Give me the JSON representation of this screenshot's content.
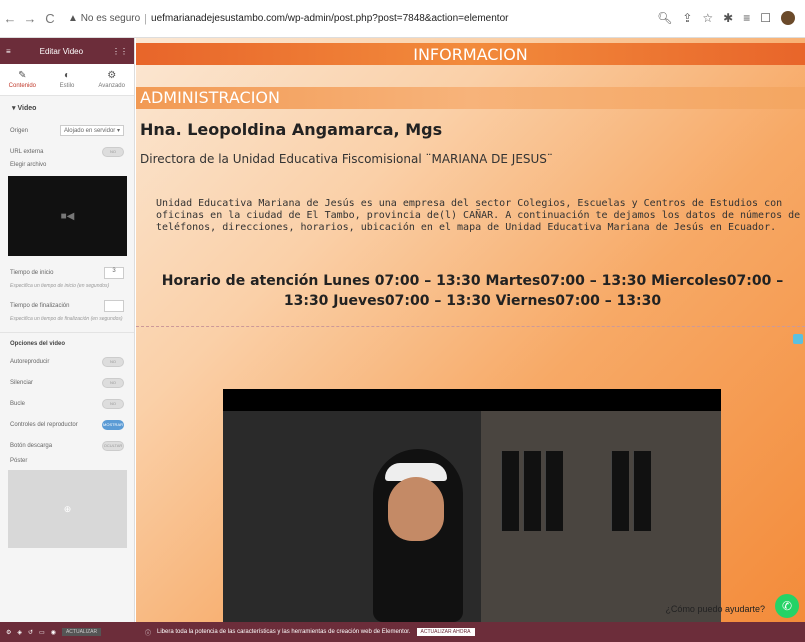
{
  "browser": {
    "warning": "No es seguro",
    "url": "uefmarianadejesustambo.com/wp-admin/post.php?post=7848&action=elementor"
  },
  "sidebar": {
    "title": "Editar Video",
    "tabs": [
      "Contenido",
      "Estilo",
      "Avanzado"
    ],
    "section": "Video",
    "origen_label": "Origen",
    "origen_value": "Alojado en servidor",
    "url_externa_label": "URL externa",
    "elegir_archivo_label": "Elegir archivo",
    "inicio_label": "Tiempo de inicio",
    "inicio_value": "3",
    "inicio_hint": "Especifica un tiempo de inicio (en segundos)",
    "fin_label": "Tiempo de finalización",
    "fin_hint": "Especifica un tiempo de finalización (en segundos)",
    "options_header": "Opciones del video",
    "options": [
      {
        "label": "Autoreproducir",
        "on": false,
        "text": "NO"
      },
      {
        "label": "Silenciar",
        "on": false,
        "text": "NO"
      },
      {
        "label": "Bucle",
        "on": false,
        "text": "NO"
      },
      {
        "label": "Controles del reproductor",
        "on": true,
        "text": "MOSTRAR"
      },
      {
        "label": "Botón descarga",
        "on": false,
        "text": "OCULTAR"
      }
    ],
    "poster_label": "Póster"
  },
  "page": {
    "info_title": "INFORMACION",
    "admin_title": "ADMINISTRACION",
    "name": "Hna. Leopoldina Angamarca, Mgs",
    "role": "Directora de la Unidad Educativa Fiscomisional ¨MARIANA DE JESUS¨",
    "description": "Unidad Educativa Mariana de Jesús es una empresa del sector Colegios, Escuelas y Centros de Estudios con oficinas en la ciudad de El Tambo, provincia de(l) CAÑAR. A continuación te dejamos los datos de números de teléfonos, direcciones, horarios, ubicación en el mapa de Unidad Educativa Mariana de Jesús en Ecuador.",
    "hours": "Horario de atención Lunes 07:00 – 13:30 Martes07:00 – 13:30 Miercoles07:00 – 13:30 Jueves07:00 – 13:30 Viernes07:00 – 13:30",
    "help": "¿Cómo puedo ayudarte?"
  },
  "bottom": {
    "update_label": "ACTUALIZAR",
    "notice": "Libera toda la potencia de las características y las herramientas de creación web de Elementor.",
    "notice_button": "ACTUALIZAR AHORA"
  }
}
